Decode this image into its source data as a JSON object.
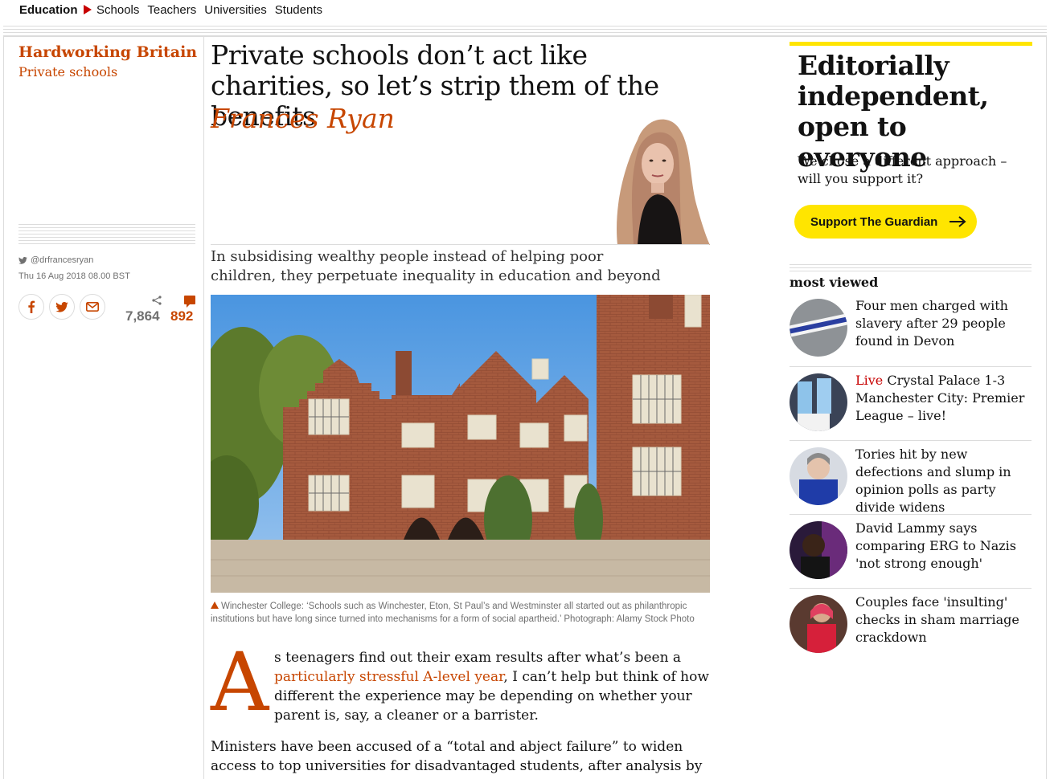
{
  "nav": {
    "section": "Education",
    "links": [
      "Schools",
      "Teachers",
      "Universities",
      "Students"
    ]
  },
  "meta": {
    "series": "Hardworking Britain",
    "subseries": "Private schools",
    "twitter": "@drfrancesryan",
    "date": "Thu 16 Aug 2018 08.00 BST",
    "share_count": "7,864",
    "comment_count": "892"
  },
  "article": {
    "headline": "Private schools don’t act like charities, so let’s strip them of the benefits",
    "byline": "Frances Ryan",
    "standfirst": "In subsidising wealthy people instead of helping poor children, they perpetuate inequality in education and beyond",
    "caption": "Winchester College: ‘Schools such as Winchester, Eton, St Paul’s and Westminster all started out as philanthropic institutions but have long since turned into mechanisms for a form of social apartheid.’ Photograph: Alamy Stock Photo",
    "dropcap": "A",
    "para1_start": "s teenagers find out their exam results after what’s been a ",
    "para1_link": "particularly stressful A-level year",
    "para1_end": ", I can’t help but think of how different the experience may be depending on whether your parent is, say, a cleaner or a barrister.",
    "para2": "Ministers have been accused of a “total and abject failure” to widen access to top universities for disadvantaged students, after analysis by the Labour"
  },
  "support": {
    "title": "Editorially independent, open to everyone",
    "subtitle": "We chose a different approach – will you support it?",
    "button": "Support The Guardian"
  },
  "most_viewed": {
    "title": "most viewed",
    "items": [
      {
        "live": "",
        "text": "Four men charged with slavery after 29 people found in Devon"
      },
      {
        "live": "Live",
        "text": "Crystal Palace 1-3 Manchester City: Premier League – live!"
      },
      {
        "live": "",
        "text": "Tories hit by new defections and slump in opinion polls as party divide widens"
      },
      {
        "live": "",
        "text": "David Lammy says comparing ERG to Nazis 'not strong enough'"
      },
      {
        "live": "",
        "text": "Couples face 'insulting' checks in sham marriage crackdown"
      }
    ]
  },
  "colors": {
    "accent": "#c74600",
    "support_yellow": "#ffe500",
    "live_red": "#c70000"
  }
}
